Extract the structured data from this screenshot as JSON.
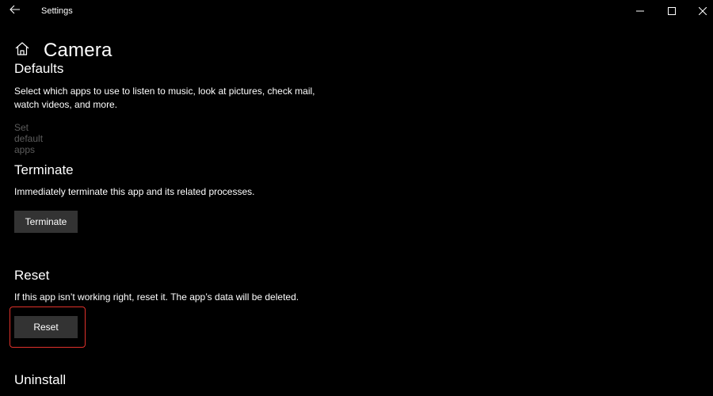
{
  "window": {
    "title": "Settings"
  },
  "header": {
    "title": "Camera"
  },
  "sections": {
    "defaults": {
      "heading": "Defaults",
      "description_line1": "Select which apps to use to listen to music, look at pictures, check mail,",
      "description_line2": "watch videos, and more.",
      "link": "Set default apps"
    },
    "terminate": {
      "heading": "Terminate",
      "description": "Immediately terminate this app and its related processes.",
      "button": "Terminate"
    },
    "reset": {
      "heading": "Reset",
      "description": "If this app isn’t working right, reset it. The app’s data will be deleted.",
      "button": "Reset"
    },
    "uninstall": {
      "heading": "Uninstall"
    }
  },
  "colors": {
    "background": "#000000",
    "button": "#333333",
    "disabled_text": "#5c5c5c",
    "highlight": "#e0312b"
  }
}
